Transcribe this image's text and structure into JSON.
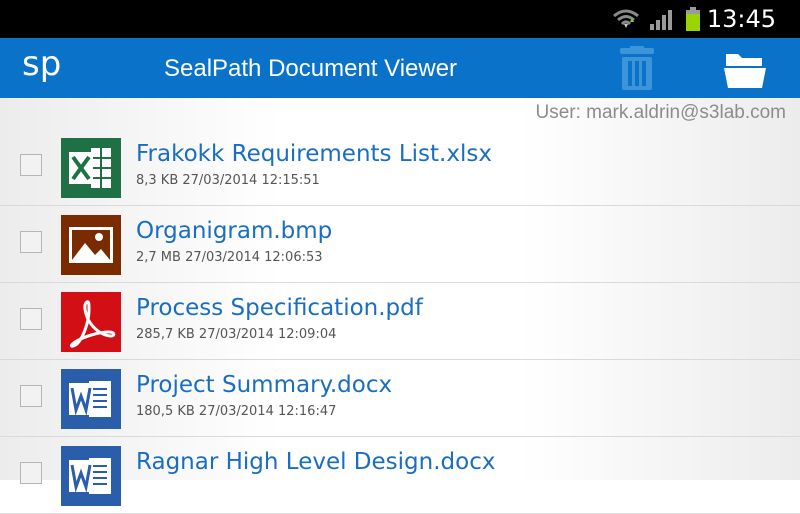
{
  "status_bar": {
    "time": "13:45",
    "icons": [
      "wifi-icon",
      "signal-icon",
      "battery-icon"
    ]
  },
  "app_bar": {
    "logo": "sp",
    "title": "SealPath Document Viewer",
    "actions": [
      "trash-icon",
      "open-folder-icon"
    ],
    "color": "#0a72c9"
  },
  "user_line": "User: mark.aldrin@s3lab.com",
  "files": [
    {
      "name": "Frakokk Requirements List.xlsx",
      "meta": "8,3 KB 27/03/2014 12:15:51",
      "icon": "excel-icon",
      "icon_color": "#1f7145"
    },
    {
      "name": "Organigram.bmp",
      "meta": "2,7 MB 27/03/2014 12:06:53",
      "icon": "image-icon",
      "icon_color": "#7a2b00"
    },
    {
      "name": "Process Specification.pdf",
      "meta": "285,7 KB 27/03/2014 12:09:04",
      "icon": "pdf-icon",
      "icon_color": "#d10f14"
    },
    {
      "name": "Project Summary.docx",
      "meta": "180,5 KB 27/03/2014 12:16:47",
      "icon": "word-icon",
      "icon_color": "#2a5eaa"
    },
    {
      "name": "Ragnar High Level Design.docx",
      "meta": "",
      "icon": "word-icon",
      "icon_color": "#2a5eaa"
    }
  ]
}
